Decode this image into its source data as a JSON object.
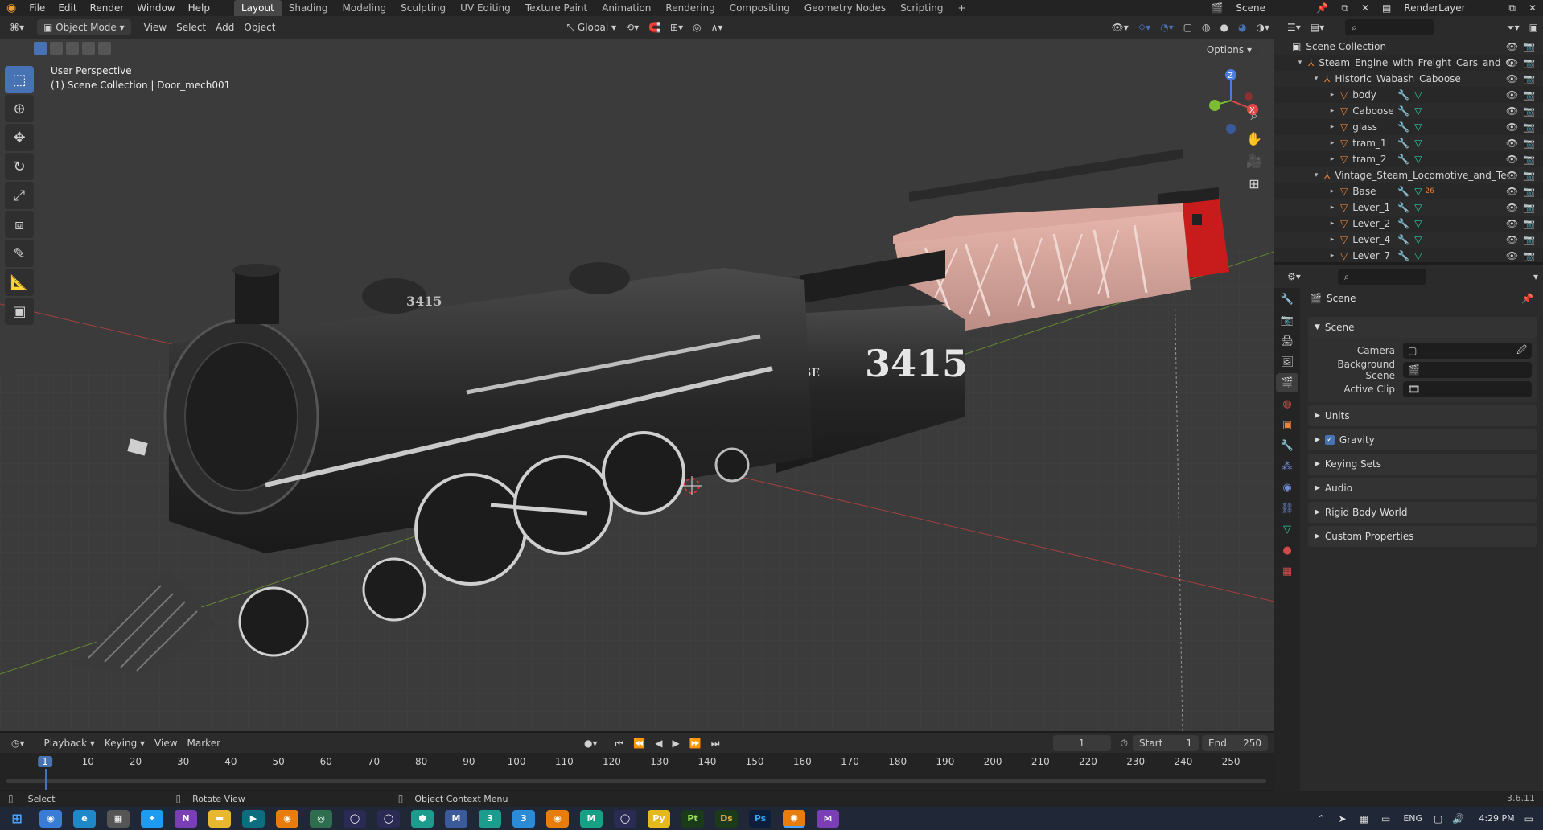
{
  "topbar": {
    "menus": [
      "File",
      "Edit",
      "Render",
      "Window",
      "Help"
    ],
    "workspaces": [
      "Layout",
      "Shading",
      "Modeling",
      "Sculpting",
      "UV Editing",
      "Texture Paint",
      "Animation",
      "Rendering",
      "Compositing",
      "Geometry Nodes",
      "Scripting"
    ],
    "active_workspace": "Layout",
    "add_tab": "+",
    "scene_name": "Scene",
    "render_layer": "RenderLayer"
  },
  "viewport_header": {
    "mode": "Object Mode",
    "menus": [
      "View",
      "Select",
      "Add",
      "Object"
    ],
    "orientation": "Global",
    "options": "Options"
  },
  "viewport": {
    "perspective": "User Perspective",
    "collection_info": "(1) Scene Collection | Door_mech001",
    "tender_number": "3415",
    "tender_lettering": "AT&SE",
    "boiler_number": "3415",
    "gizmo": {
      "x": "X",
      "y": "Y",
      "z": "Z"
    }
  },
  "outliner": {
    "items": [
      {
        "label": "Scene Collection",
        "depth": 0,
        "icon": "collection-icon"
      },
      {
        "label": "Steam_Engine_with_Freight_Cars_and_C",
        "depth": 1,
        "icon": "empty-icon"
      },
      {
        "label": "Historic_Wabash_Caboose",
        "depth": 2,
        "icon": "empty-icon"
      },
      {
        "label": "body",
        "depth": 3,
        "icon": "mesh-icon"
      },
      {
        "label": "Caboose",
        "depth": 3,
        "icon": "mesh-icon"
      },
      {
        "label": "glass",
        "depth": 3,
        "icon": "mesh-icon"
      },
      {
        "label": "tram_1",
        "depth": 3,
        "icon": "mesh-icon"
      },
      {
        "label": "tram_2",
        "depth": 3,
        "icon": "mesh-icon"
      },
      {
        "label": "Vintage_Steam_Locomotive_and_Te",
        "depth": 2,
        "icon": "empty-icon"
      },
      {
        "label": "Base",
        "depth": 3,
        "icon": "mesh-icon",
        "badge": "26"
      },
      {
        "label": "Lever_1",
        "depth": 3,
        "icon": "mesh-icon"
      },
      {
        "label": "Lever_2",
        "depth": 3,
        "icon": "mesh-icon"
      },
      {
        "label": "Lever_4",
        "depth": 3,
        "icon": "mesh-icon"
      },
      {
        "label": "Lever_7",
        "depth": 3,
        "icon": "mesh-icon"
      }
    ]
  },
  "properties": {
    "title": "Scene",
    "panel_title": "Scene",
    "camera_label": "Camera",
    "background_label": "Background Scene",
    "clip_label": "Active Clip",
    "subpanels": [
      "Units",
      "Gravity",
      "Keying Sets",
      "Audio",
      "Rigid Body World",
      "Custom Properties"
    ],
    "gravity_checked": true
  },
  "timeline": {
    "menus": [
      "Playback",
      "Keying",
      "View",
      "Marker"
    ],
    "current_frame": "1",
    "start_label": "Start",
    "start_value": "1",
    "end_label": "End",
    "end_value": "250",
    "ticks": [
      "1",
      "10",
      "20",
      "30",
      "40",
      "50",
      "60",
      "70",
      "80",
      "90",
      "100",
      "110",
      "120",
      "130",
      "140",
      "150",
      "160",
      "170",
      "180",
      "190",
      "200",
      "210",
      "220",
      "230",
      "240",
      "250"
    ]
  },
  "statusbar": {
    "select": "Select",
    "rotate": "Rotate View",
    "context": "Object Context Menu",
    "version": "3.6.11"
  },
  "taskbar": {
    "lang": "ENG",
    "time": "4:29 PM"
  },
  "colors": {
    "accent": "#4772b3",
    "viewport_bg": "#3b3b3b",
    "panel_bg": "#2b2b2b",
    "mesh_icon": "#e8823a",
    "modifier_icon": "#6f8dd6",
    "data_icon": "#31c7a1"
  }
}
